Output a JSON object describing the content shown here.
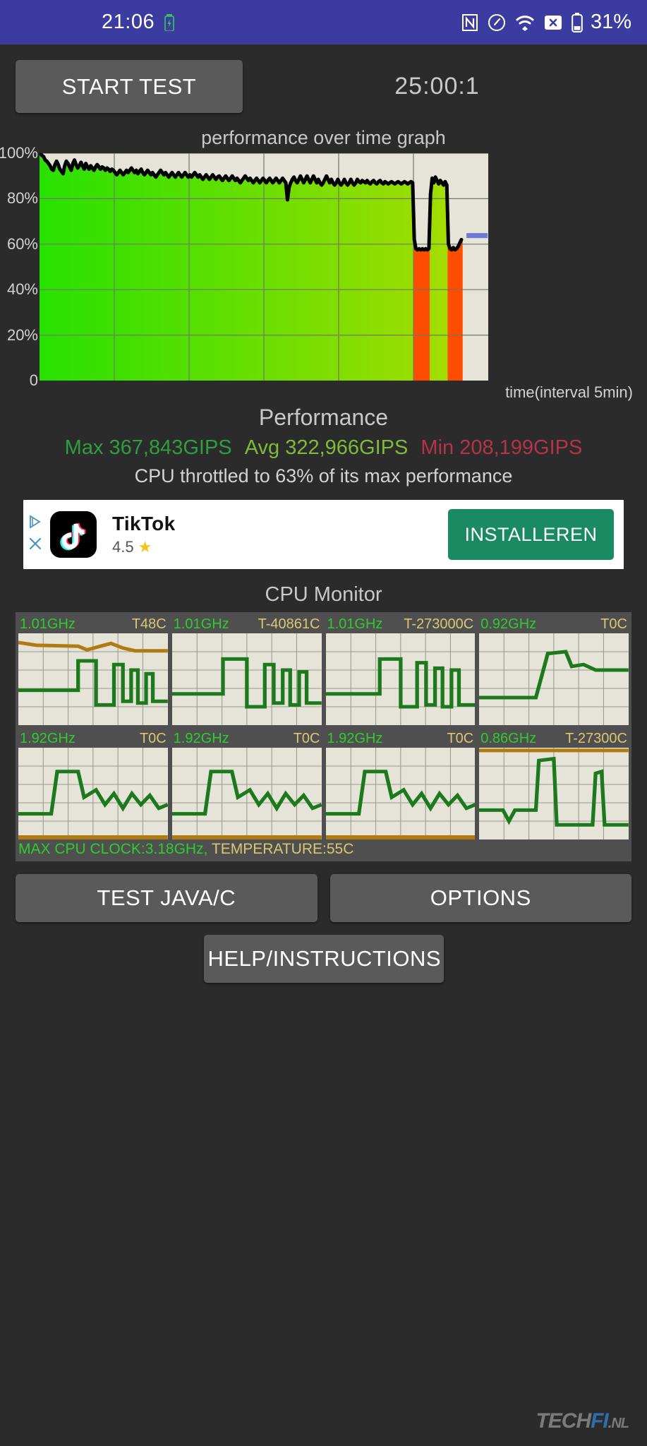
{
  "statusbar": {
    "time": "21:06",
    "battery_percent": "31%",
    "icons": [
      "battery-charging-icon",
      "nfc-icon",
      "speedometer-icon",
      "wifi-icon",
      "sms-blocked-icon",
      "battery-icon"
    ]
  },
  "toolbar": {
    "start_label": "START TEST",
    "timer": "25:00:1"
  },
  "graph": {
    "title": "performance over time graph",
    "xlabel": "time(interval 5min)"
  },
  "performance": {
    "heading": "Performance",
    "max_label": "Max 367,843GIPS",
    "avg_label": "Avg 322,966GIPS",
    "min_label": "Min 208,199GIPS",
    "max_color": "#2f9e3f",
    "avg_color": "#7fba3a",
    "min_color": "#b5334a",
    "throttle_note": "CPU throttled to 63% of its max performance"
  },
  "ad": {
    "app_name": "TikTok",
    "rating": "4.5",
    "install_label": "INSTALLEREN",
    "accent_color": "#1a8a62"
  },
  "cpu_monitor": {
    "title": "CPU Monitor",
    "cells": [
      {
        "freq": "1.01GHz",
        "temp": "T48C"
      },
      {
        "freq": "1.01GHz",
        "temp": "T-40861C"
      },
      {
        "freq": "1.01GHz",
        "temp": "T-273000C"
      },
      {
        "freq": "0.92GHz",
        "temp": "T0C"
      },
      {
        "freq": "1.92GHz",
        "temp": "T0C"
      },
      {
        "freq": "1.92GHz",
        "temp": "T0C"
      },
      {
        "freq": "1.92GHz",
        "temp": "T0C"
      },
      {
        "freq": "0.86GHz",
        "temp": "T-27300C"
      }
    ],
    "footer_clock": "MAX CPU CLOCK:3.18GHz,",
    "footer_temp": "TEMPERATURE:55C"
  },
  "buttons": {
    "test_java_c": "TEST JAVA/C",
    "options": "OPTIONS",
    "help": "HELP/INSTRUCTIONS"
  },
  "watermark": {
    "tech": "TECH",
    "fi": "FI",
    "nl": ".NL"
  },
  "chart_data": {
    "type": "area",
    "title": "performance over time graph",
    "xlabel": "time(interval 5min)",
    "ylabel": "",
    "ylim": [
      0,
      100
    ],
    "yticks": [
      0,
      20,
      40,
      60,
      80,
      100
    ],
    "ytick_labels": [
      "0",
      "20%",
      "40%",
      "60%",
      "80%",
      "100%"
    ],
    "grid": true,
    "x_gridlines": 5,
    "throttle_line_percent": 63,
    "values": [
      100,
      99,
      98.5,
      97,
      96.5,
      95.5,
      94.5,
      93,
      92.5,
      95,
      96.5,
      95,
      93,
      92,
      91,
      94.5,
      96.5,
      95.5,
      94,
      92.5,
      95.5,
      97,
      95,
      93.5,
      94.5,
      96,
      94.5,
      93,
      95.5,
      94,
      93,
      94.5,
      93.5,
      92.5,
      94,
      95,
      94,
      93,
      94,
      93.5,
      92.5,
      93.5,
      93,
      92,
      93,
      92.5,
      91.5,
      90.5,
      91.5,
      92.5,
      91.5,
      90.5,
      91.5,
      92.5,
      91.5,
      92.5,
      93.5,
      92.5,
      91.5,
      92.5,
      91,
      92,
      93,
      91.5,
      90.5,
      91.5,
      92.5,
      91.5,
      90.5,
      91.5,
      90.5,
      89.5,
      90.5,
      91.5,
      92.5,
      91.5,
      90.5,
      91.5,
      90.5,
      89.5,
      90.5,
      91.5,
      90.5,
      89.5,
      90.5,
      91.5,
      90.5,
      89.5,
      90.5,
      91.5,
      90.5,
      89.5,
      90.5,
      89.5,
      90.5,
      91.5,
      90.5,
      89.5,
      90.5,
      89.5,
      88.5,
      89.5,
      90.5,
      89.5,
      88.5,
      89.5,
      90.5,
      89.5,
      88.5,
      89.5,
      90,
      89,
      88,
      89,
      90,
      89,
      88,
      89,
      90,
      89,
      88,
      89,
      88,
      87,
      88,
      89,
      90,
      89,
      88,
      89,
      88,
      87,
      88,
      89,
      88,
      87,
      88,
      89,
      88,
      87,
      88,
      89,
      88,
      87,
      88,
      89,
      88,
      87,
      88,
      89,
      88,
      87,
      79.5,
      85,
      87,
      88.5,
      89.5,
      88,
      87,
      88.5,
      90,
      88.5,
      87,
      88.5,
      90,
      88.5,
      87,
      88.5,
      90,
      88.5,
      87,
      88.5,
      87,
      86,
      87,
      88.5,
      90,
      88.5,
      87,
      88.5,
      87,
      86,
      87,
      88.5,
      87,
      86,
      87,
      88.5,
      87,
      86,
      87,
      88.5,
      87,
      86,
      87,
      88.5,
      87.5,
      87,
      88,
      87.5,
      87,
      88,
      87,
      86.5,
      87.5,
      88,
      87,
      86.5,
      87.5,
      88,
      87,
      86.5,
      87.5,
      87,
      86.5,
      87,
      87.5,
      87,
      86.5,
      87,
      87.5,
      87,
      86.5,
      87,
      87.5,
      87,
      86.5,
      87,
      87.5,
      87,
      62,
      58,
      57.5,
      58,
      57.5,
      58,
      57.5,
      58,
      57.5,
      58,
      82,
      89,
      87,
      89.5,
      88,
      86.5,
      88,
      87,
      86,
      87.5,
      86,
      60,
      58,
      57.5,
      58.5,
      57.5,
      58,
      59,
      60.5,
      62
    ],
    "throttled_indices_start": 230,
    "series_note": "bars colored green->yellow-green by value; orange when CPU throttled heavily (<65%)"
  }
}
